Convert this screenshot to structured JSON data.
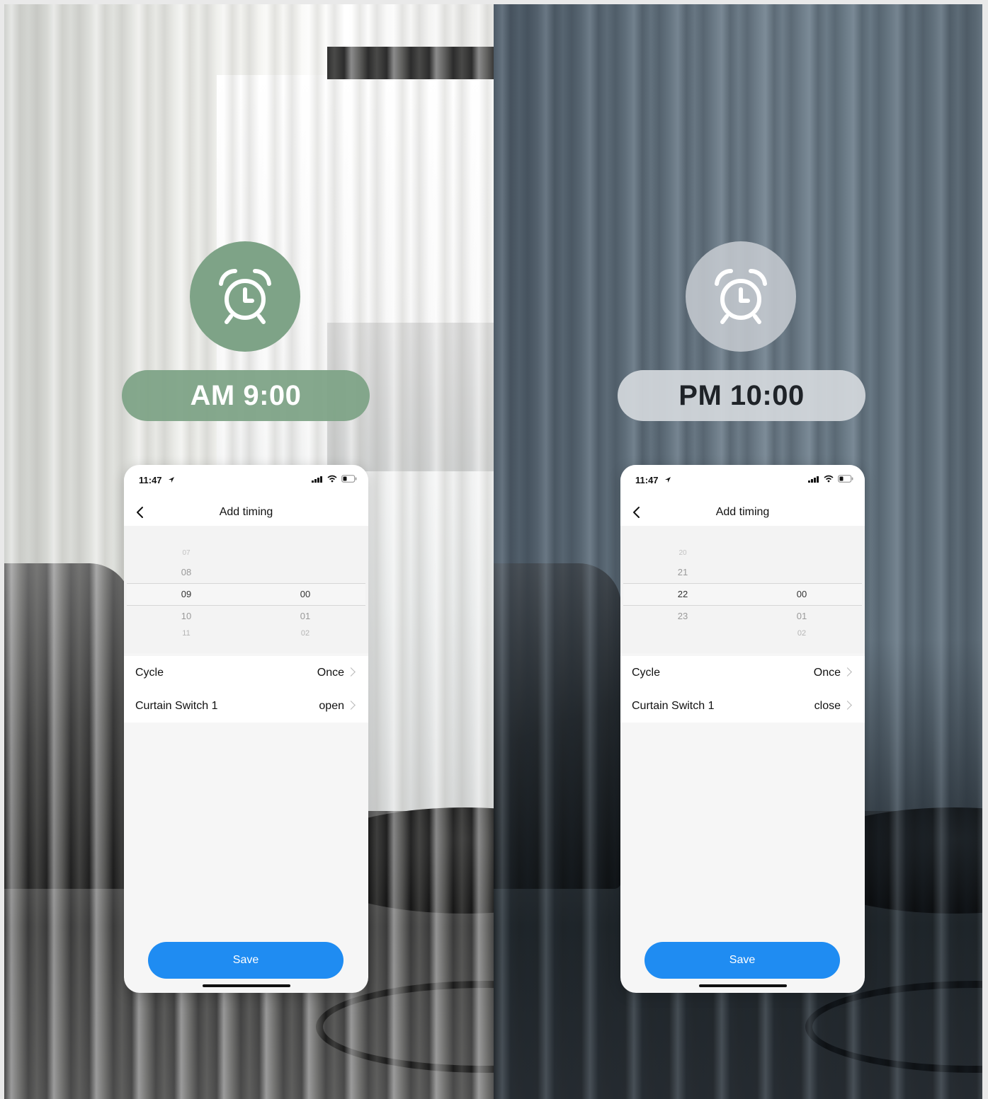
{
  "panels": [
    {
      "time_label": "AM 9:00",
      "phone": {
        "status_time": "11:47",
        "nav_title": "Add timing",
        "picker": {
          "hours": [
            "07",
            "08",
            "09",
            "10",
            "11"
          ],
          "minutes": [
            "00",
            "01",
            "02"
          ],
          "selected_hour": "09",
          "selected_minute": "00"
        },
        "rows": [
          {
            "label": "Cycle",
            "value": "Once"
          },
          {
            "label": "Curtain Switch 1",
            "value": "open"
          }
        ],
        "save_label": "Save"
      }
    },
    {
      "time_label": "PM 10:00",
      "phone": {
        "status_time": "11:47",
        "nav_title": "Add timing",
        "picker": {
          "hours": [
            "20",
            "21",
            "22",
            "23"
          ],
          "minutes": [
            "00",
            "01",
            "02"
          ],
          "selected_hour": "22",
          "selected_minute": "00"
        },
        "rows": [
          {
            "label": "Cycle",
            "value": "Once"
          },
          {
            "label": "Curtain Switch 1",
            "value": "close"
          }
        ],
        "save_label": "Save"
      }
    }
  ],
  "colors": {
    "day_accent": "#7ea387",
    "night_accent": "#d4d8dc",
    "save_button": "#1f8cf2"
  },
  "icons": {
    "alarm": "alarm-clock-icon",
    "back": "back-arrow-icon",
    "chevron": "chevron-right-icon",
    "signal": "signal-icon",
    "wifi": "wifi-icon",
    "battery": "battery-icon",
    "location": "location-arrow-icon"
  }
}
